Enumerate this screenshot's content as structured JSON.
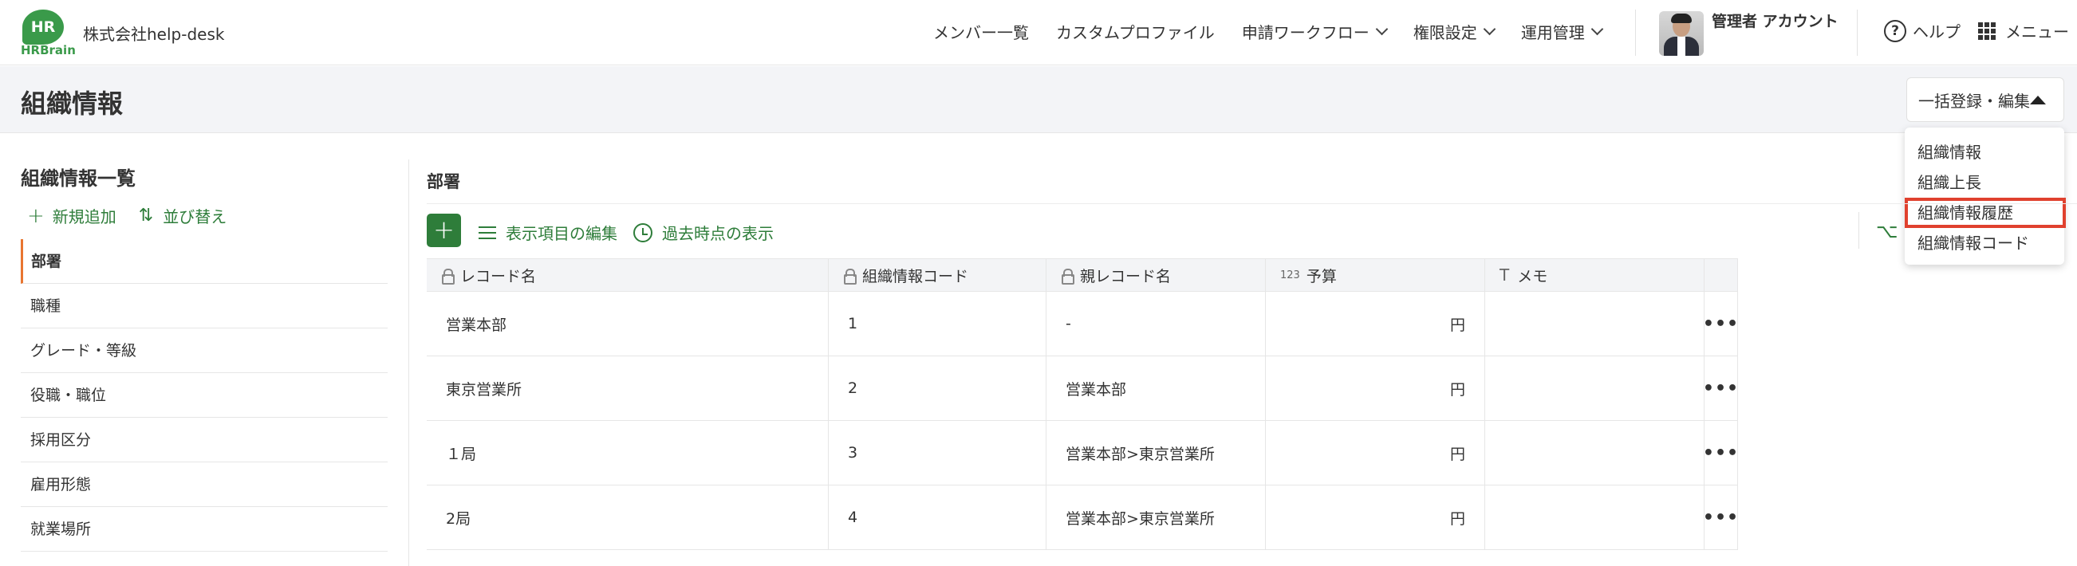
{
  "header": {
    "logo_mark": "HR",
    "logo_text": "HRBrain",
    "company": "株式会社help-desk",
    "nav": [
      {
        "label": "メンバー一覧",
        "dropdown": false
      },
      {
        "label": "カスタムプロファイル",
        "dropdown": false
      },
      {
        "label": "申請ワークフロー",
        "dropdown": true
      },
      {
        "label": "権限設定",
        "dropdown": true
      },
      {
        "label": "運用管理",
        "dropdown": true
      }
    ],
    "account": "管理者 アカウント",
    "help": "ヘルプ",
    "menu": "メニュー"
  },
  "title_bar": {
    "title": "組織情報",
    "bulk_button": "一括登録・編集"
  },
  "dropdown": {
    "items": [
      "組織情報",
      "組織上長",
      "組織情報履歴",
      "組織情報コード"
    ],
    "highlighted_index": 2,
    "highlight_color": "#e0412e"
  },
  "left_panel": {
    "title": "組織情報一覧",
    "add_label": "新規追加",
    "sort_label": "並び替え",
    "items": [
      "部署",
      "職種",
      "グレード・等級",
      "役職・職位",
      "採用区分",
      "雇用形態",
      "就業場所"
    ],
    "active_index": 0
  },
  "main": {
    "title": "部署",
    "edit_columns_label": "表示項目の編集",
    "past_view_label": "過去時点の表示",
    "columns": [
      {
        "label": "レコード名",
        "icon": "lock-icon"
      },
      {
        "label": "組織情報コード",
        "icon": "lock-icon"
      },
      {
        "label": "親レコード名",
        "icon": "lock-icon"
      },
      {
        "label": "予算",
        "icon": "number-icon",
        "icon_text": "123"
      },
      {
        "label": "メモ",
        "icon": "text-icon",
        "icon_text": "T"
      }
    ],
    "rows": [
      {
        "name": "営業本部",
        "code": "1",
        "parent": "-",
        "budget": "円",
        "memo": ""
      },
      {
        "name": "東京営業所",
        "code": "2",
        "parent": "営業本部",
        "budget": "円",
        "memo": ""
      },
      {
        "name": "１局",
        "code": "3",
        "parent": "営業本部>東京営業所",
        "budget": "円",
        "memo": ""
      },
      {
        "name": "2局",
        "code": "4",
        "parent": "営業本部>東京営業所",
        "budget": "円",
        "memo": ""
      }
    ],
    "row_menu_glyph": "•••"
  },
  "colors": {
    "brand_green": "#3a9a4a",
    "action_green": "#2e7d3a",
    "active_accent": "#e87530"
  }
}
